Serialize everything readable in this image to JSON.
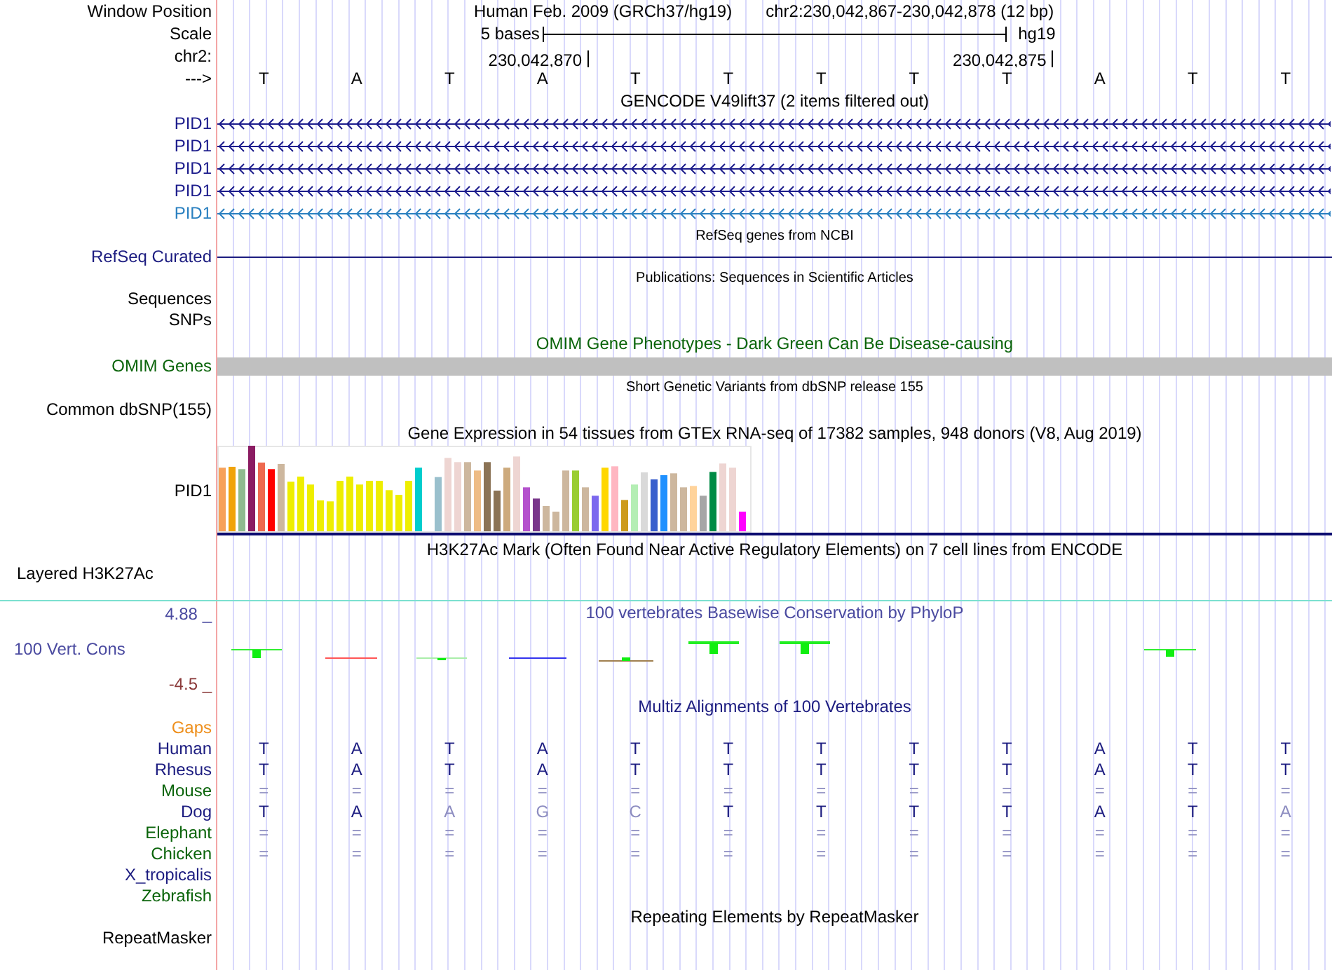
{
  "ruler": {
    "window_position_label": "Window Position",
    "assembly": "Human Feb. 2009 (GRCh37/hg19)",
    "position": "chr2:230,042,867-230,042,878 (12 bp)",
    "scale_label": "Scale",
    "scale_text": "5 bases",
    "scale_db": "hg19",
    "chrom_label": "chr2:",
    "ticks": [
      "230,042,870",
      "230,042,875"
    ],
    "strand_label": "--->",
    "bases": [
      "T",
      "A",
      "T",
      "A",
      "T",
      "T",
      "T",
      "T",
      "T",
      "A",
      "T",
      "T"
    ]
  },
  "gencode": {
    "title": "GENCODE V49lift37 (2 items filtered out)",
    "transcripts": [
      {
        "name": "PID1",
        "color": "#1c1c8c"
      },
      {
        "name": "PID1",
        "color": "#1c1c8c"
      },
      {
        "name": "PID1",
        "color": "#1c1c8c"
      },
      {
        "name": "PID1",
        "color": "#1c1c8c"
      },
      {
        "name": "PID1",
        "color": "#2a80c0"
      }
    ]
  },
  "refseq": {
    "title": "RefSeq genes from NCBI",
    "label": "RefSeq Curated"
  },
  "publications": {
    "title": "Publications: Sequences in Scientific Articles",
    "labels": [
      "Sequences",
      "SNPs"
    ]
  },
  "omim": {
    "title": "OMIM Gene Phenotypes - Dark Green Can Be Disease-causing",
    "label": "OMIM Genes"
  },
  "dbsnp": {
    "title": "Short Genetic Variants from dbSNP release 155",
    "label": "Common dbSNP(155)"
  },
  "gtex": {
    "title": "Gene Expression in 54 tissues from GTEx RNA-seq of 17382 samples, 948 donors (V8, Aug 2019)",
    "label": "PID1"
  },
  "h3k27ac": {
    "title": "H3K27Ac Mark (Often Found Near Active Regulatory Elements) on 7 cell lines from ENCODE",
    "label": "Layered H3K27Ac"
  },
  "phylop": {
    "title": "100 vertebrates Basewise Conservation by PhyloP",
    "label": "100 Vert. Cons",
    "max": "4.88 _",
    "min": "-4.5 _"
  },
  "multiz": {
    "title": "Multiz Alignments of 100 Vertebrates",
    "gaps_label": "Gaps",
    "species": [
      {
        "name": "Human",
        "color": "#1c1c80",
        "cells": [
          {
            "base": "T",
            "faded": false
          },
          {
            "base": "A",
            "faded": false
          },
          {
            "base": "T",
            "faded": false
          },
          {
            "base": "A",
            "faded": false
          },
          {
            "base": "T",
            "faded": false
          },
          {
            "base": "T",
            "faded": false
          },
          {
            "base": "T",
            "faded": false
          },
          {
            "base": "T",
            "faded": false
          },
          {
            "base": "T",
            "faded": false
          },
          {
            "base": "A",
            "faded": false
          },
          {
            "base": "T",
            "faded": false
          },
          {
            "base": "T",
            "faded": false
          }
        ]
      },
      {
        "name": "Rhesus",
        "color": "#1c1c80",
        "cells": [
          {
            "base": "T",
            "faded": false
          },
          {
            "base": "A",
            "faded": false
          },
          {
            "base": "T",
            "faded": false
          },
          {
            "base": "A",
            "faded": false
          },
          {
            "base": "T",
            "faded": false
          },
          {
            "base": "T",
            "faded": false
          },
          {
            "base": "T",
            "faded": false
          },
          {
            "base": "T",
            "faded": false
          },
          {
            "base": "T",
            "faded": false
          },
          {
            "base": "A",
            "faded": false
          },
          {
            "base": "T",
            "faded": false
          },
          {
            "base": "T",
            "faded": false
          }
        ]
      },
      {
        "name": "Mouse",
        "color": "#0a640a",
        "cells": [
          {
            "base": "=",
            "faded": true
          },
          {
            "base": "=",
            "faded": true
          },
          {
            "base": "=",
            "faded": true
          },
          {
            "base": "=",
            "faded": true
          },
          {
            "base": "=",
            "faded": true
          },
          {
            "base": "=",
            "faded": true
          },
          {
            "base": "=",
            "faded": true
          },
          {
            "base": "=",
            "faded": true
          },
          {
            "base": "=",
            "faded": true
          },
          {
            "base": "=",
            "faded": true
          },
          {
            "base": "=",
            "faded": true
          },
          {
            "base": "=",
            "faded": true
          }
        ]
      },
      {
        "name": "Dog",
        "color": "#1c1c80",
        "cells": [
          {
            "base": "T",
            "faded": false
          },
          {
            "base": "A",
            "faded": false
          },
          {
            "base": "A",
            "faded": true
          },
          {
            "base": "G",
            "faded": true
          },
          {
            "base": "C",
            "faded": true
          },
          {
            "base": "T",
            "faded": false
          },
          {
            "base": "T",
            "faded": false
          },
          {
            "base": "T",
            "faded": false
          },
          {
            "base": "T",
            "faded": false
          },
          {
            "base": "A",
            "faded": false
          },
          {
            "base": "T",
            "faded": false
          },
          {
            "base": "A",
            "faded": true
          }
        ]
      },
      {
        "name": "Elephant",
        "color": "#0a640a",
        "cells": [
          {
            "base": "=",
            "faded": true
          },
          {
            "base": "=",
            "faded": true
          },
          {
            "base": "=",
            "faded": true
          },
          {
            "base": "=",
            "faded": true
          },
          {
            "base": "=",
            "faded": true
          },
          {
            "base": "=",
            "faded": true
          },
          {
            "base": "=",
            "faded": true
          },
          {
            "base": "=",
            "faded": true
          },
          {
            "base": "=",
            "faded": true
          },
          {
            "base": "=",
            "faded": true
          },
          {
            "base": "=",
            "faded": true
          },
          {
            "base": "=",
            "faded": true
          }
        ]
      },
      {
        "name": "Chicken",
        "color": "#0a640a",
        "cells": [
          {
            "base": "=",
            "faded": true
          },
          {
            "base": "=",
            "faded": true
          },
          {
            "base": "=",
            "faded": true
          },
          {
            "base": "=",
            "faded": true
          },
          {
            "base": "=",
            "faded": true
          },
          {
            "base": "=",
            "faded": true
          },
          {
            "base": "=",
            "faded": true
          },
          {
            "base": "=",
            "faded": true
          },
          {
            "base": "=",
            "faded": true
          },
          {
            "base": "=",
            "faded": true
          },
          {
            "base": "=",
            "faded": true
          },
          {
            "base": "=",
            "faded": true
          }
        ]
      },
      {
        "name": "X_tropicalis",
        "color": "#1c1c80"
      },
      {
        "name": "Zebrafish",
        "color": "#0a640a"
      }
    ]
  },
  "repeatmasker": {
    "title": "Repeating Elements by RepeatMasker",
    "label": "RepeatMasker"
  }
}
